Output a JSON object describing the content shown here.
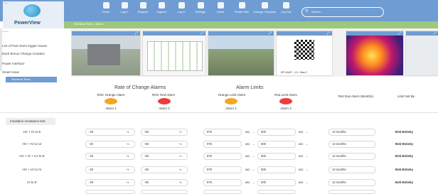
{
  "app": {
    "name": "PowerView",
    "tab_label": "------",
    "section_title": "Electrical Tests - Main 1"
  },
  "nav": [
    {
      "label": "Home",
      "icon": "home-icon"
    },
    {
      "label": "Log in",
      "icon": "login-icon"
    },
    {
      "label": "Register",
      "icon": "register-icon"
    },
    {
      "label": "Support",
      "icon": "support-icon"
    },
    {
      "label": "Log in",
      "icon": "globe-icon"
    },
    {
      "label": "Settings",
      "icon": "gear-icon"
    },
    {
      "label": "Guest",
      "icon": "user-icon"
    },
    {
      "label": "Profile Man",
      "icon": "profile-icon"
    },
    {
      "label": "Change Company",
      "icon": "company-icon"
    },
    {
      "label": "Log Out",
      "icon": "logout-icon"
    }
  ],
  "search": {
    "placeholder": "Search..."
  },
  "left_menu": [
    "------",
    "List of Past Alarm trigger Issues",
    "Each Bonus Change Actuates",
    "Power Interface",
    "Smart Issue"
  ],
  "current_tab": "Electrical Tests",
  "thumbnails": [
    {
      "type": "substation-photo"
    },
    {
      "type": "schematic"
    },
    {
      "type": "aerial-photo"
    },
    {
      "type": "qr-code",
      "caption": "IRT #1607 - 1.5 - Bias 2"
    },
    {
      "type": "thermal-image"
    },
    {
      "type": "panel"
    }
  ],
  "roc": {
    "heading": "Rate of Change Alarms",
    "orange_label": "ROC Orange Alarm",
    "red_label": "ROC Red Alarm",
    "alarm1": "Alarm 1",
    "alarm2": "Alarm 2"
  },
  "limits": {
    "heading": "Alarm Limits",
    "orange_label": "Orange Limit Alarm",
    "red_label": "Red Limit Alarm",
    "alarm1": "Alarm 1",
    "alarm2": "Alarm 2"
  },
  "columns": {
    "test_due": "Test Due Alarm (Months)",
    "limit_set_by": "Limit Set By"
  },
  "colors": {
    "orange": "#f4a623",
    "red": "#ee3b3b",
    "nav": "#6f9cd2",
    "green": "#9cc77c"
  },
  "group_label": "Insulation resistance test",
  "rows": [
    {
      "label": "HV + IV to E",
      "roc_orange": "-20",
      "roc_red": "-50",
      "lim_orange": "975",
      "unit1": "MΩ",
      "lim_red": "500",
      "unit2": "MΩ",
      "due": "12 months",
      "set_by": "Bob Bobsky"
    },
    {
      "label": "HV + IV to LV",
      "roc_orange": "-20",
      "roc_red": "-50",
      "lim_orange": "975",
      "unit1": "MΩ",
      "lim_red": "500",
      "unit2": "MΩ",
      "due": "12 months",
      "set_by": "Bob Bobsky"
    },
    {
      "label": "HV + IV + LV to E",
      "roc_orange": "-20",
      "roc_red": "-50",
      "lim_orange": "975",
      "unit1": "MΩ",
      "lim_red": "500",
      "unit2": "MΩ",
      "due": "12 months",
      "set_by": "Bob Bobsky"
    },
    {
      "label": "HV + LV to IV",
      "roc_orange": "-20",
      "roc_red": "-50",
      "lim_orange": "975",
      "unit1": "MΩ",
      "lim_red": "500",
      "unit2": "MΩ",
      "due": "12 months",
      "set_by": "Bob Bobsky"
    },
    {
      "label": "IV to E",
      "roc_orange": "-20",
      "roc_red": "-50",
      "lim_orange": "975",
      "unit1": "MΩ",
      "lim_red": "500",
      "unit2": "MΩ",
      "due": "12 months",
      "set_by": "Bob Bobsky"
    },
    {
      "label": "",
      "roc_orange": "",
      "roc_red": "",
      "lim_orange": "",
      "unit1": "",
      "lim_red": "",
      "unit2": "",
      "due": "",
      "set_by": ""
    }
  ]
}
